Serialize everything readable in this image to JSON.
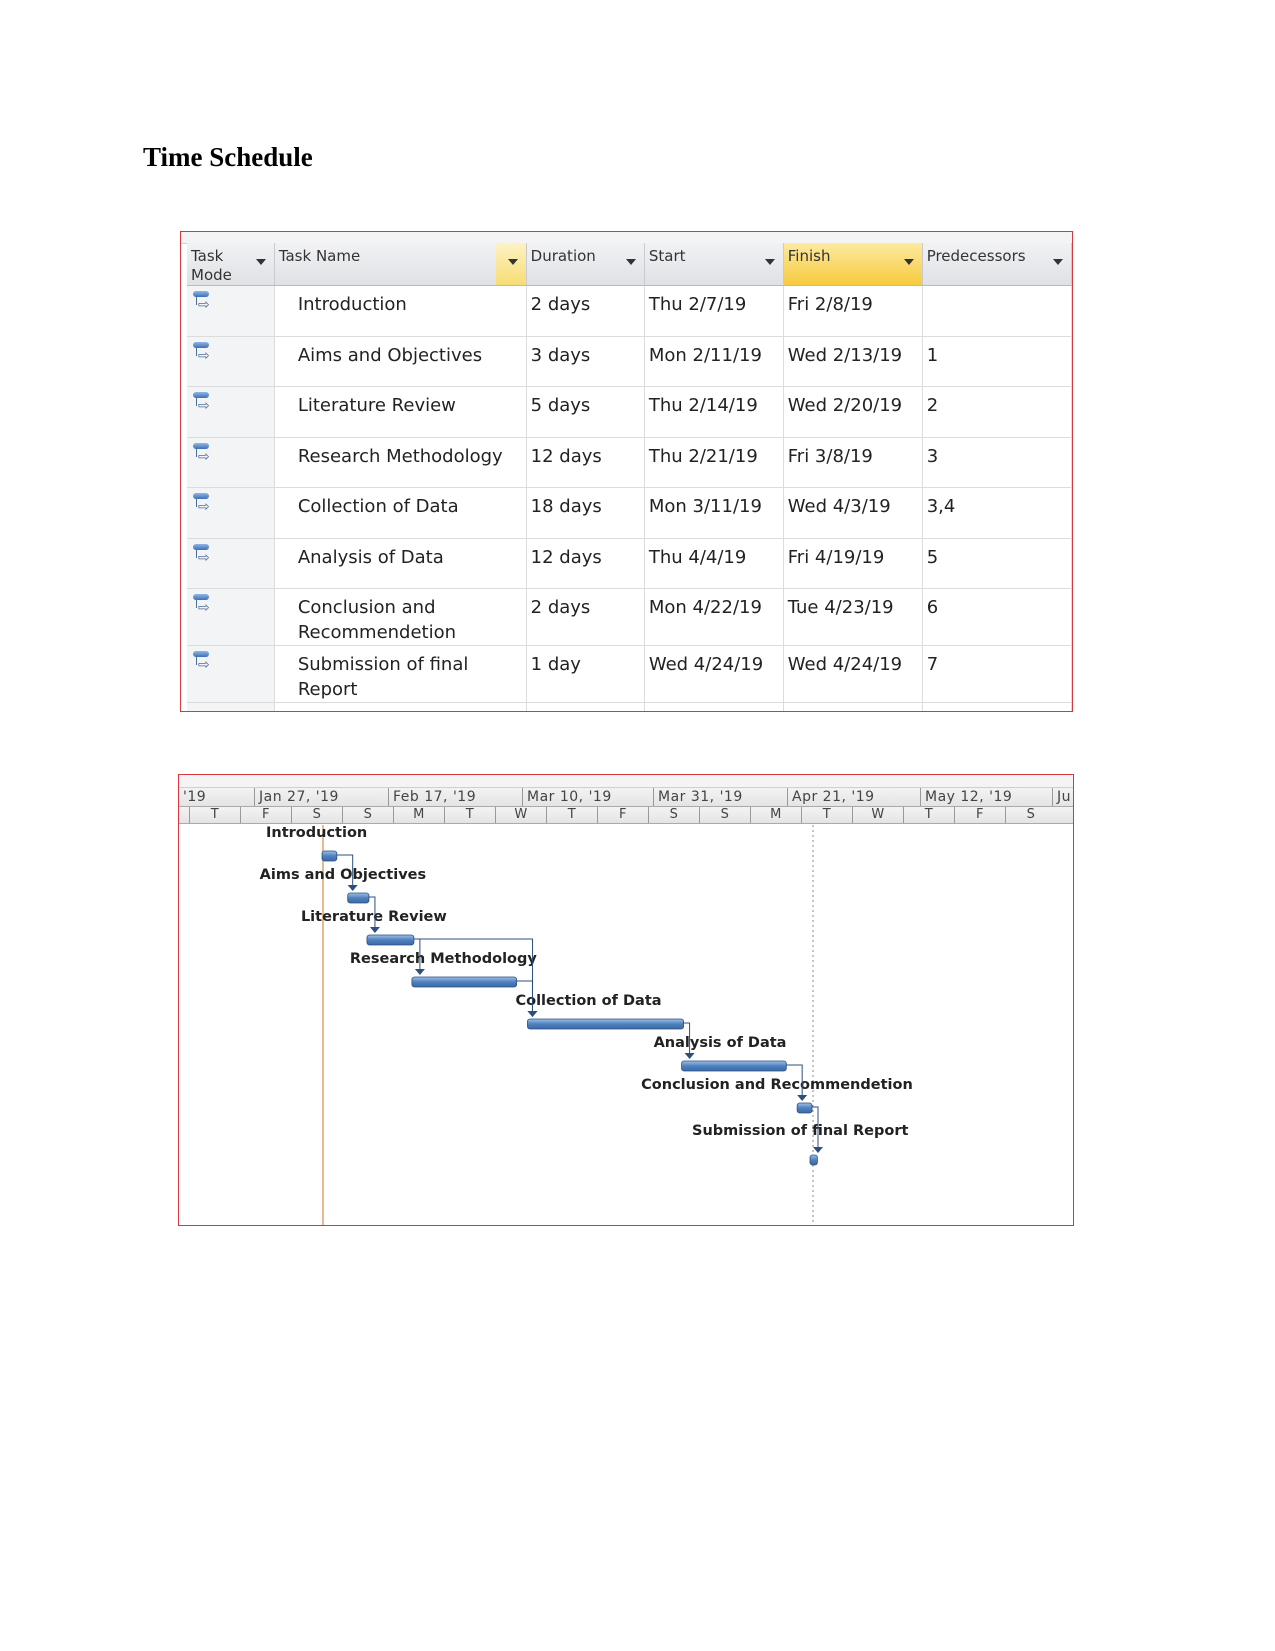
{
  "page": {
    "title": "Time Schedule"
  },
  "table": {
    "columns": [
      {
        "label": "Task\nMode",
        "line1": "Task",
        "line2": "Mode"
      },
      {
        "label": "Task Name"
      },
      {
        "label": "Duration"
      },
      {
        "label": "Start"
      },
      {
        "label": "Finish"
      },
      {
        "label": "Predecessors"
      }
    ],
    "task_mode_icon": "auto-scheduled-task-icon",
    "dropdown_icon": "chevron-down-icon",
    "rows": [
      {
        "name": [
          "Introduction"
        ],
        "duration": "2 days",
        "start": "Thu 2/7/19",
        "finish": "Fri 2/8/19",
        "predecessors": ""
      },
      {
        "name": [
          "Aims and Objectives"
        ],
        "duration": "3 days",
        "start": "Mon 2/11/19",
        "finish": "Wed 2/13/19",
        "predecessors": "1"
      },
      {
        "name": [
          "Literature Review"
        ],
        "duration": "5 days",
        "start": "Thu 2/14/19",
        "finish": "Wed 2/20/19",
        "predecessors": "2"
      },
      {
        "name": [
          "Research Methodology"
        ],
        "duration": "12 days",
        "start": "Thu 2/21/19",
        "finish": "Fri 3/8/19",
        "predecessors": "3"
      },
      {
        "name": [
          "Collection of Data"
        ],
        "duration": "18 days",
        "start": "Mon 3/11/19",
        "finish": "Wed 4/3/19",
        "predecessors": "3,4"
      },
      {
        "name": [
          "Analysis of Data"
        ],
        "duration": "12 days",
        "start": "Thu 4/4/19",
        "finish": "Fri 4/19/19",
        "predecessors": "5"
      },
      {
        "name": [
          "Conclusion and",
          "Recommendetion"
        ],
        "duration": "2 days",
        "start": "Mon 4/22/19",
        "finish": "Tue 4/23/19",
        "predecessors": "6"
      },
      {
        "name": [
          "Submission of final",
          "Report"
        ],
        "duration": "1 day",
        "start": "Wed 4/24/19",
        "finish": "Wed 4/24/19",
        "predecessors": "7"
      }
    ]
  },
  "gantt": {
    "timescale_major": [
      "'19",
      "Jan 27, '19",
      "Feb 17, '19",
      "Mar 10, '19",
      "Mar 31, '19",
      "Apr 21, '19",
      "May 12, '19",
      "Ju"
    ],
    "timescale_minor": [
      "T",
      "F",
      "S",
      "S",
      "M",
      "T",
      "W",
      "T",
      "F",
      "S",
      "S",
      "M",
      "T",
      "W",
      "T",
      "F",
      "S"
    ],
    "colors": {
      "bar": "#4f81bd",
      "bar_dark": "#2c4f7c",
      "link": "#2c4f7c",
      "project_start_line": "#e3a06a",
      "status_line": "#888888"
    },
    "chart_data": {
      "type": "gantt",
      "title": "",
      "xlabel": "",
      "ylabel": "",
      "timescale_days_per_major_unit": 21,
      "x_range": [
        "2019-01-03",
        "2019-06-02"
      ],
      "project_start_marker": "2019-02-07",
      "status_date_marker": "2019-04-24",
      "tasks": [
        {
          "id": 1,
          "label": "Introduction",
          "start": "2019-02-07",
          "finish": "2019-02-08",
          "predecessors": []
        },
        {
          "id": 2,
          "label": "Aims and Objectives",
          "start": "2019-02-11",
          "finish": "2019-02-13",
          "predecessors": [
            1
          ]
        },
        {
          "id": 3,
          "label": "Literature Review",
          "start": "2019-02-14",
          "finish": "2019-02-20",
          "predecessors": [
            2
          ]
        },
        {
          "id": 4,
          "label": "Research Methodology",
          "start": "2019-02-21",
          "finish": "2019-03-08",
          "predecessors": [
            3
          ]
        },
        {
          "id": 5,
          "label": "Collection of Data",
          "start": "2019-03-11",
          "finish": "2019-04-03",
          "predecessors": [
            3,
            4
          ]
        },
        {
          "id": 6,
          "label": "Analysis of Data",
          "start": "2019-04-04",
          "finish": "2019-04-19",
          "predecessors": [
            5
          ]
        },
        {
          "id": 7,
          "label": "Conclusion and Recommendetion",
          "start": "2019-04-22",
          "finish": "2019-04-23",
          "predecessors": [
            6
          ]
        },
        {
          "id": 8,
          "label": "Submission of final Report",
          "start": "2019-04-24",
          "finish": "2019-04-24",
          "predecessors": [
            7
          ]
        }
      ]
    }
  }
}
